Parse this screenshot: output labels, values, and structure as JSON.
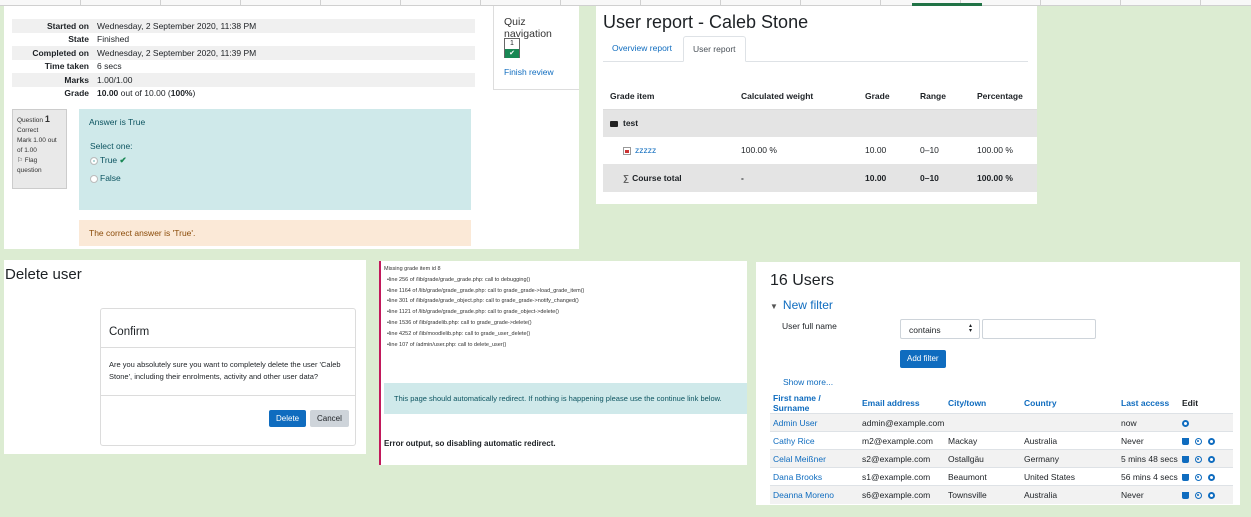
{
  "quiz": {
    "summary": [
      {
        "label": "Started on",
        "value": "Wednesday, 2 September 2020, 11:38 PM"
      },
      {
        "label": "State",
        "value": "Finished"
      },
      {
        "label": "Completed on",
        "value": "Wednesday, 2 September 2020, 11:39 PM"
      },
      {
        "label": "Time taken",
        "value": "6 secs"
      },
      {
        "label": "Marks",
        "value": "1.00/1.00"
      }
    ],
    "grade_label": "Grade",
    "grade_value": "10.00",
    "grade_rest": " out of 10.00 (",
    "grade_pct": "100%",
    "grade_close": ")",
    "question": {
      "prefix": "Question",
      "number": "1",
      "status": "Correct",
      "mark": "Mark 1.00 out of 1.00",
      "flag": "Flag question"
    },
    "prompt": "Answer is True",
    "select_one": "Select one:",
    "options": [
      "True",
      "False"
    ],
    "correct_mark": "✔",
    "feedback": "The correct answer is 'True'.",
    "nav": {
      "title": "Quiz navigation",
      "button": "1",
      "finish": "Finish review"
    }
  },
  "grades": {
    "title": "User report - Caleb Stone",
    "tabs": [
      "Overview report",
      "User report"
    ],
    "headers": [
      "Grade item",
      "Calculated weight",
      "Grade",
      "Range",
      "Percentage"
    ],
    "category": "test",
    "item": {
      "name": "zzzzz",
      "weight": "100.00 %",
      "grade": "10.00",
      "range": "0–10",
      "percentage": "100.00 %"
    },
    "total": {
      "name": "Course total",
      "weight": "-",
      "grade": "10.00",
      "range": "0–10",
      "percentage": "100.00 %"
    }
  },
  "delete_user": {
    "title": "Delete user",
    "dialog_title": "Confirm",
    "message": "Are you absolutely sure you want to completely delete the user 'Caleb Stone', including their enrolments, activity and other user data?",
    "delete_label": "Delete",
    "cancel_label": "Cancel"
  },
  "debug": {
    "heading": "Missing grade item id 8",
    "lines": [
      "line 256 of /lib/grade/grade_grade.php: call to debugging()",
      "line 1164 of /lib/grade/grade_grade.php: call to grade_grade->load_grade_item()",
      "line 301 of /lib/grade/grade_object.php: call to grade_grade->notify_changed()",
      "line 1121 of /lib/grade/grade_grade.php: call to grade_object->delete()",
      "line 1536 of /lib/gradelib.php: call to grade_grade->delete()",
      "line 4252 of /lib/moodlelib.php: call to grade_user_delete()",
      "line 107 of /admin/user.php: call to delete_user()"
    ],
    "redirect": "This page should automatically redirect. If nothing is happening please use the continue link below.",
    "error": "Error output, so disabling automatic redirect."
  },
  "users": {
    "title": "16 Users",
    "new_filter": "New filter",
    "filter_label": "User full name",
    "filter_op": "contains",
    "add_filter": "Add filter",
    "show_more": "Show more...",
    "headers": [
      "First name / Surname",
      "Email address",
      "City/town",
      "Country",
      "Last access",
      "Edit"
    ],
    "rows": [
      {
        "name": "Admin User",
        "email": "admin@example.com",
        "city": "",
        "country": "",
        "access": "now"
      },
      {
        "name": "Cathy Rice",
        "email": "m2@example.com",
        "city": "Mackay",
        "country": "Australia",
        "access": "Never"
      },
      {
        "name": "Celal Meißner",
        "email": "s2@example.com",
        "city": "Ostallgäu",
        "country": "Germany",
        "access": "5 mins 48 secs"
      },
      {
        "name": "Dana Brooks",
        "email": "s1@example.com",
        "city": "Beaumont",
        "country": "United States",
        "access": "56 mins 4 secs"
      },
      {
        "name": "Deanna Moreno",
        "email": "s6@example.com",
        "city": "Townsville",
        "country": "Australia",
        "access": "Never"
      }
    ]
  },
  "colors": {
    "accent": "#0f6cbf",
    "success": "#198754",
    "info_bg": "#cfe9ea",
    "warn_bg": "#fbe9d7",
    "debug_border": "#c2185b",
    "page_bg": "#dcecd2"
  }
}
